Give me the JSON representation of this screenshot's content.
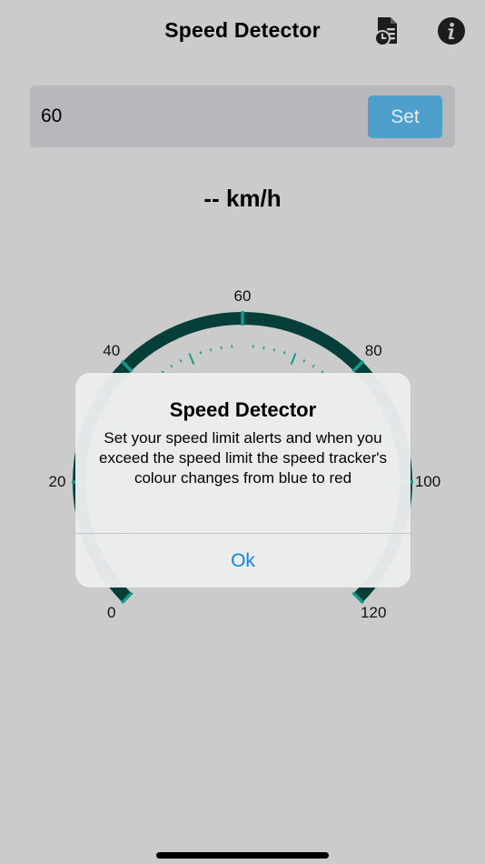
{
  "header": {
    "title": "Speed Detector"
  },
  "speed_limit": {
    "value": "60",
    "set_label": "Set"
  },
  "speed": {
    "value": "--",
    "unit": "km/h"
  },
  "gauge": {
    "min": 0,
    "max": 120,
    "labels": [
      "0",
      "20",
      "40",
      "60",
      "80",
      "100",
      "120"
    ],
    "arc_color": "#063f3a",
    "tick_color": "#16998c",
    "background_color": "#cbcbcb"
  },
  "alert": {
    "title": "Speed Detector",
    "message": "Set your speed limit alerts and when you exceed the speed limit the speed tracker's colour changes from blue to red",
    "ok_label": "Ok"
  },
  "colors": {
    "accent_button": "#4e9fcb",
    "link": "#1a7ee0"
  }
}
